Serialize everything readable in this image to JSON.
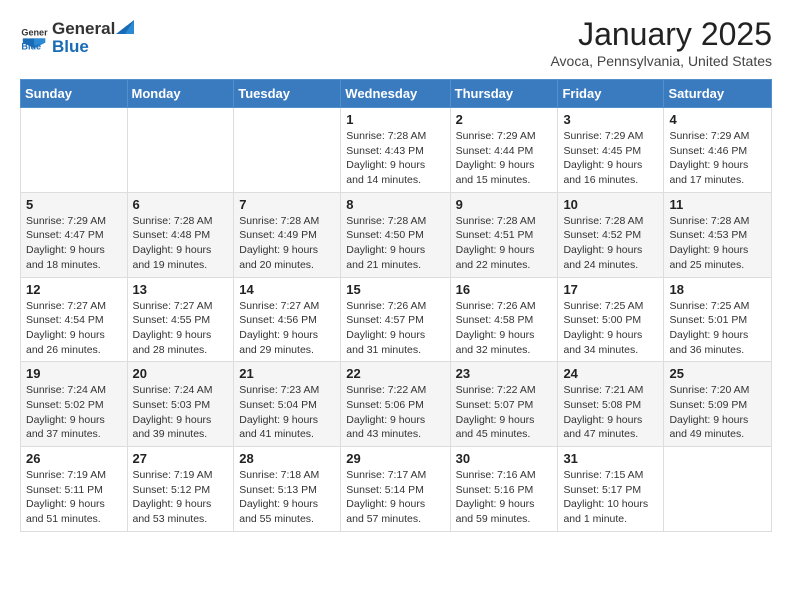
{
  "header": {
    "logo_general": "General",
    "logo_blue": "Blue",
    "month_title": "January 2025",
    "location": "Avoca, Pennsylvania, United States"
  },
  "weekdays": [
    "Sunday",
    "Monday",
    "Tuesday",
    "Wednesday",
    "Thursday",
    "Friday",
    "Saturday"
  ],
  "weeks": [
    [
      {
        "day": "",
        "info": ""
      },
      {
        "day": "",
        "info": ""
      },
      {
        "day": "",
        "info": ""
      },
      {
        "day": "1",
        "info": "Sunrise: 7:28 AM\nSunset: 4:43 PM\nDaylight: 9 hours\nand 14 minutes."
      },
      {
        "day": "2",
        "info": "Sunrise: 7:29 AM\nSunset: 4:44 PM\nDaylight: 9 hours\nand 15 minutes."
      },
      {
        "day": "3",
        "info": "Sunrise: 7:29 AM\nSunset: 4:45 PM\nDaylight: 9 hours\nand 16 minutes."
      },
      {
        "day": "4",
        "info": "Sunrise: 7:29 AM\nSunset: 4:46 PM\nDaylight: 9 hours\nand 17 minutes."
      }
    ],
    [
      {
        "day": "5",
        "info": "Sunrise: 7:29 AM\nSunset: 4:47 PM\nDaylight: 9 hours\nand 18 minutes."
      },
      {
        "day": "6",
        "info": "Sunrise: 7:28 AM\nSunset: 4:48 PM\nDaylight: 9 hours\nand 19 minutes."
      },
      {
        "day": "7",
        "info": "Sunrise: 7:28 AM\nSunset: 4:49 PM\nDaylight: 9 hours\nand 20 minutes."
      },
      {
        "day": "8",
        "info": "Sunrise: 7:28 AM\nSunset: 4:50 PM\nDaylight: 9 hours\nand 21 minutes."
      },
      {
        "day": "9",
        "info": "Sunrise: 7:28 AM\nSunset: 4:51 PM\nDaylight: 9 hours\nand 22 minutes."
      },
      {
        "day": "10",
        "info": "Sunrise: 7:28 AM\nSunset: 4:52 PM\nDaylight: 9 hours\nand 24 minutes."
      },
      {
        "day": "11",
        "info": "Sunrise: 7:28 AM\nSunset: 4:53 PM\nDaylight: 9 hours\nand 25 minutes."
      }
    ],
    [
      {
        "day": "12",
        "info": "Sunrise: 7:27 AM\nSunset: 4:54 PM\nDaylight: 9 hours\nand 26 minutes."
      },
      {
        "day": "13",
        "info": "Sunrise: 7:27 AM\nSunset: 4:55 PM\nDaylight: 9 hours\nand 28 minutes."
      },
      {
        "day": "14",
        "info": "Sunrise: 7:27 AM\nSunset: 4:56 PM\nDaylight: 9 hours\nand 29 minutes."
      },
      {
        "day": "15",
        "info": "Sunrise: 7:26 AM\nSunset: 4:57 PM\nDaylight: 9 hours\nand 31 minutes."
      },
      {
        "day": "16",
        "info": "Sunrise: 7:26 AM\nSunset: 4:58 PM\nDaylight: 9 hours\nand 32 minutes."
      },
      {
        "day": "17",
        "info": "Sunrise: 7:25 AM\nSunset: 5:00 PM\nDaylight: 9 hours\nand 34 minutes."
      },
      {
        "day": "18",
        "info": "Sunrise: 7:25 AM\nSunset: 5:01 PM\nDaylight: 9 hours\nand 36 minutes."
      }
    ],
    [
      {
        "day": "19",
        "info": "Sunrise: 7:24 AM\nSunset: 5:02 PM\nDaylight: 9 hours\nand 37 minutes."
      },
      {
        "day": "20",
        "info": "Sunrise: 7:24 AM\nSunset: 5:03 PM\nDaylight: 9 hours\nand 39 minutes."
      },
      {
        "day": "21",
        "info": "Sunrise: 7:23 AM\nSunset: 5:04 PM\nDaylight: 9 hours\nand 41 minutes."
      },
      {
        "day": "22",
        "info": "Sunrise: 7:22 AM\nSunset: 5:06 PM\nDaylight: 9 hours\nand 43 minutes."
      },
      {
        "day": "23",
        "info": "Sunrise: 7:22 AM\nSunset: 5:07 PM\nDaylight: 9 hours\nand 45 minutes."
      },
      {
        "day": "24",
        "info": "Sunrise: 7:21 AM\nSunset: 5:08 PM\nDaylight: 9 hours\nand 47 minutes."
      },
      {
        "day": "25",
        "info": "Sunrise: 7:20 AM\nSunset: 5:09 PM\nDaylight: 9 hours\nand 49 minutes."
      }
    ],
    [
      {
        "day": "26",
        "info": "Sunrise: 7:19 AM\nSunset: 5:11 PM\nDaylight: 9 hours\nand 51 minutes."
      },
      {
        "day": "27",
        "info": "Sunrise: 7:19 AM\nSunset: 5:12 PM\nDaylight: 9 hours\nand 53 minutes."
      },
      {
        "day": "28",
        "info": "Sunrise: 7:18 AM\nSunset: 5:13 PM\nDaylight: 9 hours\nand 55 minutes."
      },
      {
        "day": "29",
        "info": "Sunrise: 7:17 AM\nSunset: 5:14 PM\nDaylight: 9 hours\nand 57 minutes."
      },
      {
        "day": "30",
        "info": "Sunrise: 7:16 AM\nSunset: 5:16 PM\nDaylight: 9 hours\nand 59 minutes."
      },
      {
        "day": "31",
        "info": "Sunrise: 7:15 AM\nSunset: 5:17 PM\nDaylight: 10 hours\nand 1 minute."
      },
      {
        "day": "",
        "info": ""
      }
    ]
  ]
}
